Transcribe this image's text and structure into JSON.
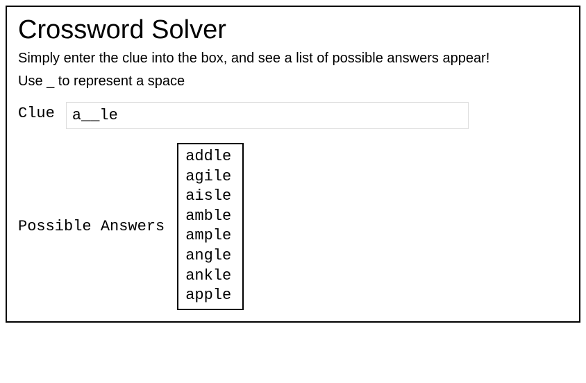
{
  "header": {
    "title": "Crossword Solver",
    "subtitle": "Simply enter the clue into the box, and see a list of possible answers appear!",
    "hint": "Use _ to represent a space"
  },
  "clue": {
    "label": "Clue",
    "value": "a__le"
  },
  "answers": {
    "label": "Possible Answers",
    "items": [
      "addle",
      "agile",
      "aisle",
      "amble",
      "ample",
      "angle",
      "ankle",
      "apple"
    ]
  }
}
